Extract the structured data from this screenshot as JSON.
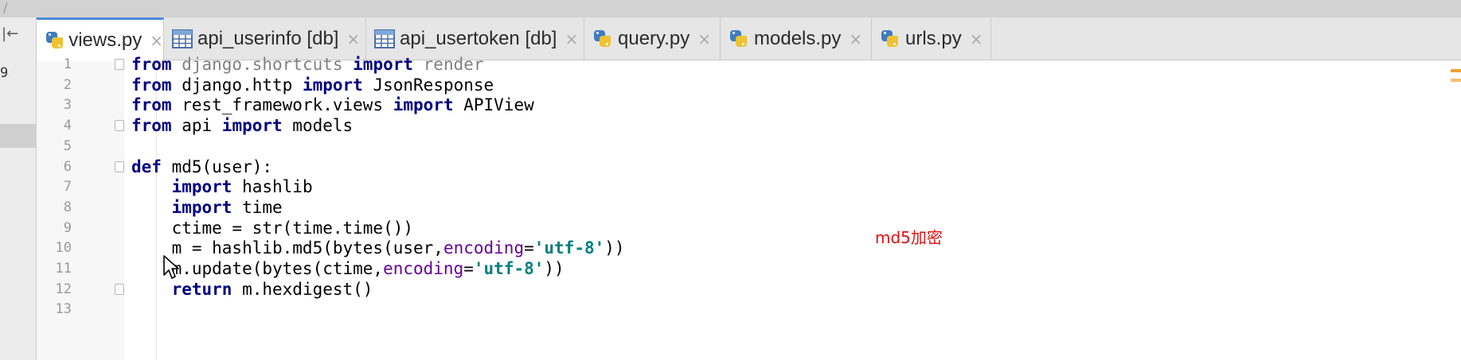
{
  "tabs": [
    {
      "label": "views.py",
      "icon": "python-file-icon",
      "active": true
    },
    {
      "label": "api_userinfo [db]",
      "icon": "db-table-icon",
      "active": false
    },
    {
      "label": "api_usertoken [db]",
      "icon": "db-table-icon",
      "active": false
    },
    {
      "label": "query.py",
      "icon": "python-file-icon",
      "active": false
    },
    {
      "label": "models.py",
      "icon": "python-file-icon",
      "active": false
    },
    {
      "label": "urls.py",
      "icon": "python-file-icon",
      "active": false
    }
  ],
  "tab_close_glyph": "×",
  "left_panel": {
    "collapse_glyph": "|←",
    "number": "9"
  },
  "top_strip": {
    "glyph": "/"
  },
  "annotation": "md5加密",
  "code_lines": [
    {
      "num": "1",
      "tokens": [
        {
          "t": "from",
          "c": "kw"
        },
        {
          "t": " django.shortcuts "
        },
        {
          "t": "import",
          "c": "kw"
        },
        {
          "t": " render"
        }
      ],
      "dim": true
    },
    {
      "num": "2",
      "tokens": [
        {
          "t": "from",
          "c": "kw"
        },
        {
          "t": " django.http "
        },
        {
          "t": "import",
          "c": "kw"
        },
        {
          "t": " JsonResponse"
        }
      ]
    },
    {
      "num": "3",
      "tokens": [
        {
          "t": "from",
          "c": "kw"
        },
        {
          "t": " rest_framework.views "
        },
        {
          "t": "import",
          "c": "kw"
        },
        {
          "t": " APIView"
        }
      ]
    },
    {
      "num": "4",
      "tokens": [
        {
          "t": "from",
          "c": "kw"
        },
        {
          "t": " api "
        },
        {
          "t": "import",
          "c": "kw"
        },
        {
          "t": " models"
        }
      ]
    },
    {
      "num": "5",
      "tokens": []
    },
    {
      "num": "6",
      "tokens": [
        {
          "t": "def",
          "c": "kw"
        },
        {
          "t": " md5(user):"
        }
      ]
    },
    {
      "num": "7",
      "tokens": [
        {
          "t": "    "
        },
        {
          "t": "import",
          "c": "kw"
        },
        {
          "t": " hashlib"
        }
      ]
    },
    {
      "num": "8",
      "tokens": [
        {
          "t": "    "
        },
        {
          "t": "import",
          "c": "kw"
        },
        {
          "t": " time"
        }
      ]
    },
    {
      "num": "9",
      "tokens": [
        {
          "t": "    ctime = str(time.time())"
        }
      ]
    },
    {
      "num": "10",
      "tokens": [
        {
          "t": "    m = hashlib.md5(bytes(user,"
        },
        {
          "t": "encoding",
          "c": "kwarg"
        },
        {
          "t": "="
        },
        {
          "t": "'utf-8'",
          "c": "str"
        },
        {
          "t": "))"
        }
      ]
    },
    {
      "num": "11",
      "tokens": [
        {
          "t": "    m.update(bytes(ctime,"
        },
        {
          "t": "encoding",
          "c": "kwarg"
        },
        {
          "t": "="
        },
        {
          "t": "'utf-8'",
          "c": "str"
        },
        {
          "t": "))"
        }
      ]
    },
    {
      "num": "12",
      "tokens": [
        {
          "t": "    "
        },
        {
          "t": "return",
          "c": "kw"
        },
        {
          "t": " m.hexdigest()"
        }
      ]
    },
    {
      "num": "13",
      "tokens": []
    }
  ],
  "colors": {
    "keyword": "#000080",
    "string": "#008080",
    "kwarg": "#660099",
    "annotation": "#e01010",
    "active_tab_accent": "#4a89dc"
  }
}
